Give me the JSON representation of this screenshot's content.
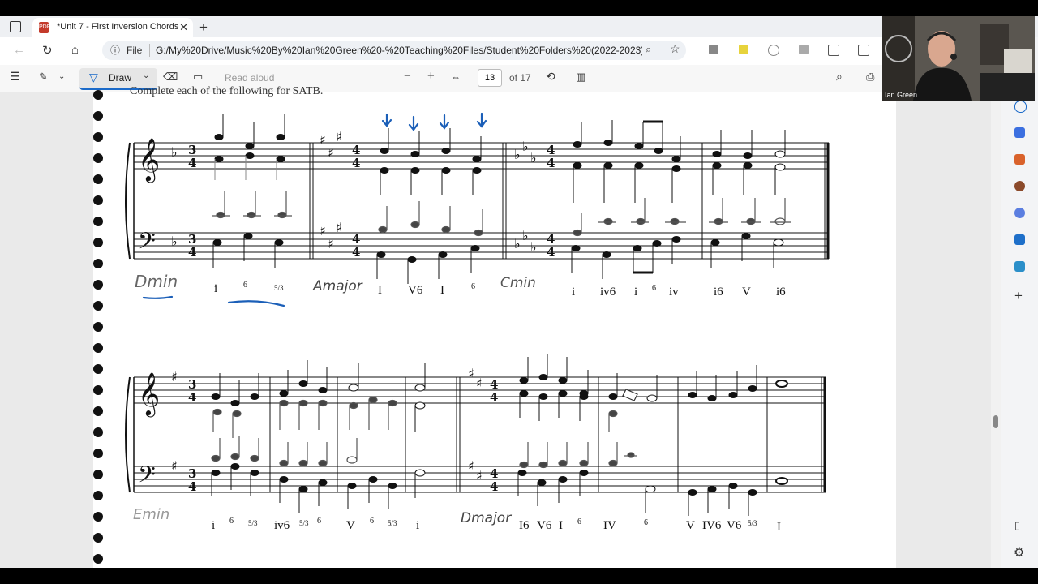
{
  "tab": {
    "title": "*Unit 7 - First Inversion Chords.pdf"
  },
  "address": {
    "scheme_label": "File",
    "url": "G:/My%20Drive/Music%20By%20Ian%20Green%20-%20Teaching%20Files/Student%20Folders%20(2022-2023)/Ja..."
  },
  "pdf_toolbar": {
    "draw_label": "Draw",
    "read_aloud_label": "Read aloud",
    "page_current": "13",
    "page_total": "of 17"
  },
  "webcam": {
    "name_label": "Ian Green"
  },
  "sheet": {
    "top_partial_text": "Complete each of the following for SATB.",
    "row1": {
      "keys": [
        "Dmin",
        "Amajor",
        "Cmin"
      ],
      "romans": [
        "i",
        "6",
        "5/3",
        "I",
        "V6",
        "I",
        "6",
        "i",
        "iv6",
        "i",
        "6",
        "iv",
        "i6",
        "V",
        "i6"
      ]
    },
    "row2": {
      "keys": [
        "Emin",
        "Dmajor"
      ],
      "romans": [
        "i",
        "6",
        "5/3",
        "iv6",
        "5/3",
        "6",
        "V",
        "6",
        "5/3",
        "i",
        "I6",
        "V6",
        "I",
        "6",
        "IV",
        "6",
        "V",
        "IV6",
        "V6",
        "5/3",
        "I"
      ]
    }
  },
  "colors": {
    "accent": "#1b6ac9",
    "ink": "#111111",
    "pencil": "#555555"
  }
}
